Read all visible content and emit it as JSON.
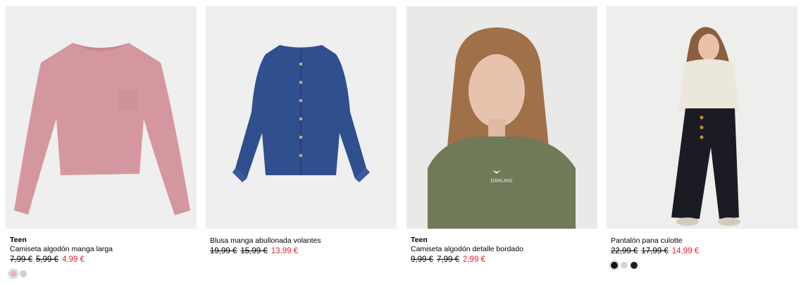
{
  "products": [
    {
      "tag": "Teen",
      "name": "Camiseta algodón manga larga",
      "old_prices": [
        "7,99 €",
        "5,99 €"
      ],
      "price": "4,99 €",
      "image_alt": "pink long sleeve t-shirt",
      "swatches": [
        "#e7b3bc",
        "#cfcfcf"
      ]
    },
    {
      "tag": "",
      "name": "Blusa manga abullonada volantes",
      "old_prices": [
        "19,99 €",
        "15,99 €"
      ],
      "price": "13,99 €",
      "image_alt": "navy blue ruffle blouse",
      "swatches": []
    },
    {
      "tag": "Teen",
      "name": "Camiseta algodón detalle bordado",
      "old_prices": [
        "9,99 €",
        "7,99 €"
      ],
      "price": "2,99 €",
      "image_alt": "girl wearing khaki t-shirt",
      "swatches": []
    },
    {
      "tag": "",
      "name": "Pantalón pana culotte",
      "old_prices": [
        "22,99 €",
        "17,99 €"
      ],
      "price": "14,99 €",
      "image_alt": "girl wearing black corduroy culottes",
      "swatches": [
        "#111111",
        "#d9d6cf",
        "#1f1f1f"
      ]
    }
  ],
  "colors": {
    "sale": "#e1262d",
    "card_background": "#efefef"
  }
}
